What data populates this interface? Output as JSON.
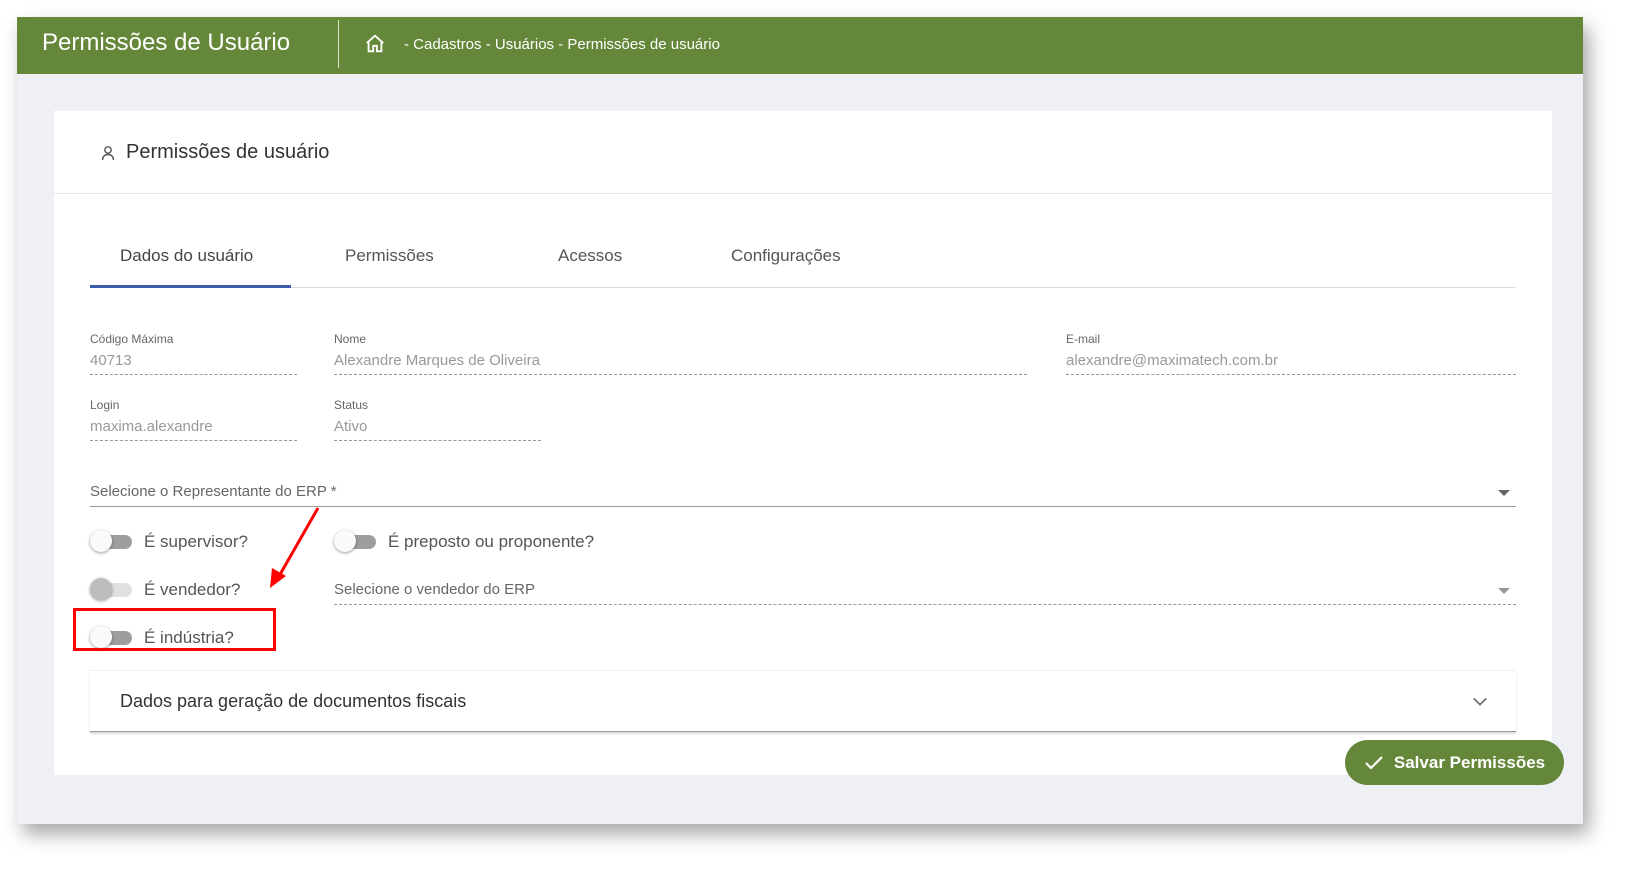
{
  "header": {
    "title": "Permissões de Usuário",
    "breadcrumb": "- Cadastros - Usuários - Permissões de usuário"
  },
  "card": {
    "title": "Permissões de usuário"
  },
  "tabs": [
    {
      "label": "Dados do usuário",
      "active": true
    },
    {
      "label": "Permissões"
    },
    {
      "label": "Acessos"
    },
    {
      "label": "Configurações"
    }
  ],
  "fields": {
    "codigo": {
      "label": "Código Máxima",
      "value": "40713"
    },
    "nome": {
      "label": "Nome",
      "value": "Alexandre Marques de Oliveira"
    },
    "email": {
      "label": "E-mail",
      "value": "alexandre@maximatech.com.br"
    },
    "login": {
      "label": "Login",
      "value": "maxima.alexandre"
    },
    "status": {
      "label": "Status",
      "value": "Ativo"
    }
  },
  "selects": {
    "representante": "Selecione o Representante do ERP *",
    "vendedor": "Selecione o vendedor do ERP"
  },
  "toggles": {
    "supervisor": "É supervisor?",
    "preposto": "É preposto ou proponente?",
    "vendedor": "É vendedor?",
    "industria": "É indústria?"
  },
  "expansion": {
    "title": "Dados para geração de documentos fiscais"
  },
  "save_button": "Salvar Permissões",
  "colors": {
    "brand": "#65873a",
    "tab_active": "#3b5aa8",
    "annotation": "#ff0000"
  }
}
